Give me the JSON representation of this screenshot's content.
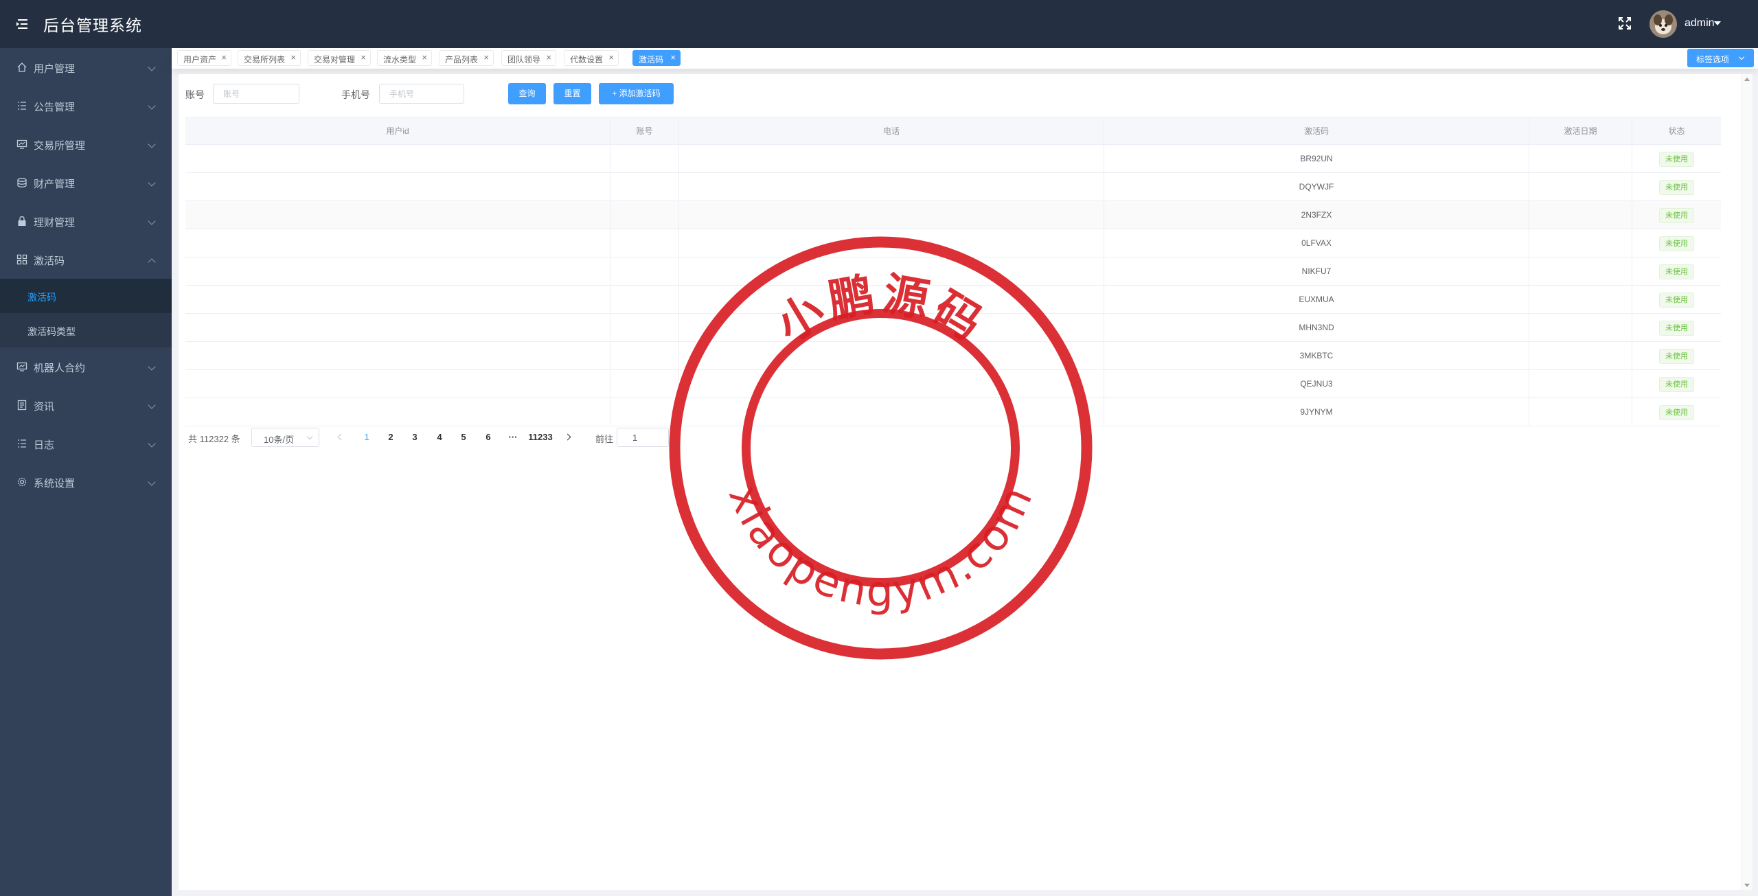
{
  "header": {
    "title": "后台管理系统",
    "username": "admin",
    "icons": {
      "menu": "menu-fold-icon",
      "fullscreen": "fullscreen-icon",
      "avatar": "avatar-image"
    }
  },
  "sidebar": {
    "items": [
      {
        "label": "用户管理",
        "icon": "home-icon",
        "expanded": false
      },
      {
        "label": "公告管理",
        "icon": "list-icon",
        "expanded": false
      },
      {
        "label": "交易所管理",
        "icon": "monitor-icon",
        "expanded": false
      },
      {
        "label": "财产管理",
        "icon": "coins-icon",
        "expanded": false
      },
      {
        "label": "理财管理",
        "icon": "lock-icon",
        "expanded": false
      },
      {
        "label": "激活码",
        "icon": "grid-icon",
        "expanded": true,
        "children": [
          {
            "label": "激活码",
            "active": true
          },
          {
            "label": "激活码类型",
            "active": false
          }
        ]
      },
      {
        "label": "机器人合约",
        "icon": "robot-icon",
        "expanded": false
      },
      {
        "label": "资讯",
        "icon": "document-icon",
        "expanded": false
      },
      {
        "label": "日志",
        "icon": "list-icon",
        "expanded": false
      },
      {
        "label": "系统设置",
        "icon": "gear-icon",
        "expanded": false
      }
    ]
  },
  "tabs": {
    "items": [
      {
        "label": "用户资产",
        "active": false
      },
      {
        "label": "交易所列表",
        "active": false
      },
      {
        "label": "交易对管理",
        "active": false
      },
      {
        "label": "流水类型",
        "active": false
      },
      {
        "label": "产品列表",
        "active": false
      },
      {
        "label": "团队领导",
        "active": false
      },
      {
        "label": "代数设置",
        "active": false
      },
      {
        "label": "激活码",
        "active": true
      }
    ],
    "close_glyph": "×",
    "options_label": "标签选项"
  },
  "filters": {
    "account_label": "账号",
    "account_placeholder": "账号",
    "account_value": "",
    "phone_label": "手机号",
    "phone_placeholder": "手机号",
    "phone_value": "",
    "search_label": "查询",
    "reset_label": "重置",
    "add_label": "+ 添加激活码"
  },
  "table": {
    "columns": [
      "用户id",
      "账号",
      "电话",
      "激活码",
      "激活日期",
      "状态"
    ],
    "rows": [
      {
        "user_id": "",
        "account": "",
        "phone": "",
        "code": "BR92UN",
        "date": "",
        "status": "未使用"
      },
      {
        "user_id": "",
        "account": "",
        "phone": "",
        "code": "DQYWJF",
        "date": "",
        "status": "未使用"
      },
      {
        "user_id": "",
        "account": "",
        "phone": "",
        "code": "2N3FZX",
        "date": "",
        "status": "未使用"
      },
      {
        "user_id": "",
        "account": "",
        "phone": "",
        "code": "0LFVAX",
        "date": "",
        "status": "未使用"
      },
      {
        "user_id": "",
        "account": "",
        "phone": "",
        "code": "NIKFU7",
        "date": "",
        "status": "未使用"
      },
      {
        "user_id": "",
        "account": "",
        "phone": "",
        "code": "EUXMUA",
        "date": "",
        "status": "未使用"
      },
      {
        "user_id": "",
        "account": "",
        "phone": "",
        "code": "MHN3ND",
        "date": "",
        "status": "未使用"
      },
      {
        "user_id": "",
        "account": "",
        "phone": "",
        "code": "3MKBTC",
        "date": "",
        "status": "未使用"
      },
      {
        "user_id": "",
        "account": "",
        "phone": "",
        "code": "QEJNU3",
        "date": "",
        "status": "未使用"
      },
      {
        "user_id": "",
        "account": "",
        "phone": "",
        "code": "9JYNYM",
        "date": "",
        "status": "未使用"
      }
    ]
  },
  "pagination": {
    "total_text": "共 112322 条",
    "page_size": "10条/页",
    "pages": [
      "1",
      "2",
      "3",
      "4",
      "5",
      "6",
      "···",
      "11233"
    ],
    "current": "1",
    "goto_label": "前往",
    "goto_value": "1"
  },
  "watermark": {
    "top_text": "小鹏源码",
    "bottom_text": "xiaopengym.com",
    "color": "#d81e25"
  },
  "colors": {
    "header_bg": "#242f42",
    "sidebar_bg": "#324157",
    "primary": "#409eff",
    "success": "#67c23a"
  }
}
